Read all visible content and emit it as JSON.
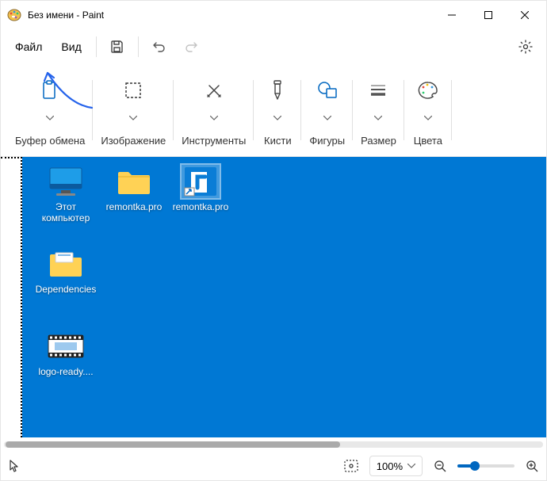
{
  "titlebar": {
    "title": "Без имени - Paint"
  },
  "menu": {
    "file": "Файл",
    "view": "Вид"
  },
  "ribbon": {
    "clipboard": "Буфер обмена",
    "image": "Изображение",
    "tools": "Инструменты",
    "brushes": "Кисти",
    "shapes": "Фигуры",
    "size": "Размер",
    "colors": "Цвета"
  },
  "desktop": {
    "thispc": "Этот компьютер",
    "folder1": "remontka.pro",
    "shortcut1": "remontka.pro",
    "deps": "Dependencies",
    "video": "logo-ready...."
  },
  "status": {
    "zoom": "100%"
  }
}
